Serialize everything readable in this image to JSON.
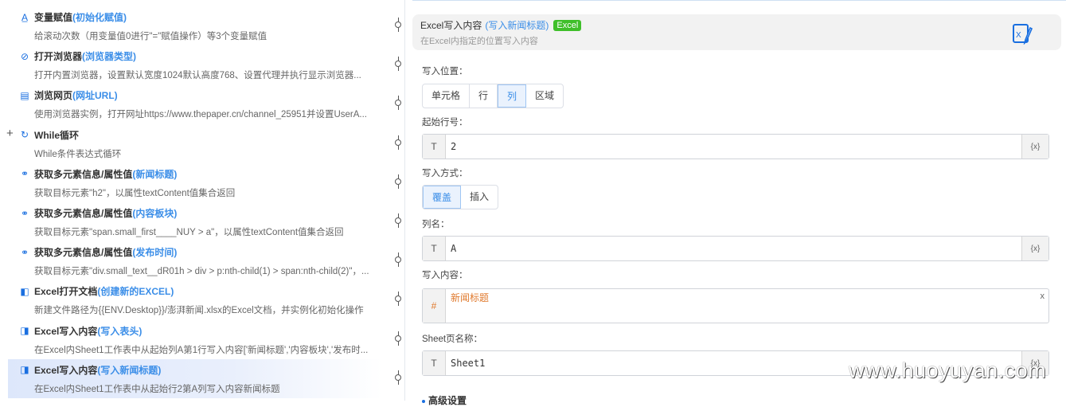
{
  "flow": [
    {
      "title": "变量赋值",
      "sub": "(初始化赋值)",
      "desc": "给滚动次数（用变量值0进行\"=\"赋值操作）等3个变量赋值",
      "icon": "variable-icon"
    },
    {
      "title": "打开浏览器",
      "sub": "(浏览器类型)",
      "desc": "打开内置浏览器，设置默认宽度1024默认高度768、设置代理并执行显示浏览器...",
      "icon": "browser-icon"
    },
    {
      "title": "浏览网页",
      "sub": "(网址URL)",
      "desc": "使用浏览器实例，打开网址https://www.thepaper.cn/channel_25951并设置UserA...",
      "icon": "webpage-icon"
    },
    {
      "title": "While循环",
      "sub": "",
      "desc": "While条件表达式循环",
      "icon": "loop-icon"
    },
    {
      "title": "获取多元素信息/属性值",
      "sub": "(新闻标题)",
      "desc": "获取目标元素\"h2\"，以属性textContent值集合返回",
      "icon": "elements-icon"
    },
    {
      "title": "获取多元素信息/属性值",
      "sub": "(内容板块)",
      "desc": "获取目标元素\"span.small_first____NUY > a\"，以属性textContent值集合返回",
      "icon": "elements-icon"
    },
    {
      "title": "获取多元素信息/属性值",
      "sub": "(发布时间)",
      "desc": "获取目标元素\"div.small_text__dR01h > div > p:nth-child(1) > span:nth-child(2)\"，...",
      "icon": "elements-icon"
    },
    {
      "title": "Excel打开文档",
      "sub": "(创建新的EXCEL)",
      "desc": "新建文件路径为{{ENV.Desktop}}/澎湃新闻.xlsx的Excel文档，并实例化初始化操作",
      "icon": "excel-open-icon"
    },
    {
      "title": "Excel写入内容",
      "sub": "(写入表头)",
      "desc": "在Excel内Sheet1工作表中从起始列A第1行写入内容['新闻标题','内容板块','发布时...",
      "icon": "excel-write-icon"
    },
    {
      "title": "Excel写入内容",
      "sub": "(写入新闻标题)",
      "desc": "在Excel内Sheet1工作表中从起始行2第A列写入内容新闻标题",
      "icon": "excel-write-icon"
    }
  ],
  "panel": {
    "title": "Excel写入内容",
    "sub": "(写入新闻标题)",
    "badge": "Excel",
    "desc": "在Excel内指定的位置写入内容",
    "position_label": "写入位置：",
    "position_options": [
      "单元格",
      "行",
      "列",
      "区域"
    ],
    "start_row_label": "起始行号：",
    "start_row": "2",
    "mode_label": "写入方式：",
    "mode_options": [
      "覆盖",
      "插入"
    ],
    "col_label": "列名：",
    "col": "A",
    "content_label": "写入内容：",
    "content": "新闻标题",
    "sheet_label": "Sheet页名称：",
    "sheet": "Sheet1",
    "advanced": "高级设置",
    "type_t": "T",
    "type_hash": "#",
    "var_btn": "{x}",
    "clear": "x"
  },
  "watermark": "www.huoyuyan.com",
  "colors": {
    "accent": "#3b8ee8",
    "badge": "#3fbf2a",
    "expr": "#e07a2e"
  }
}
